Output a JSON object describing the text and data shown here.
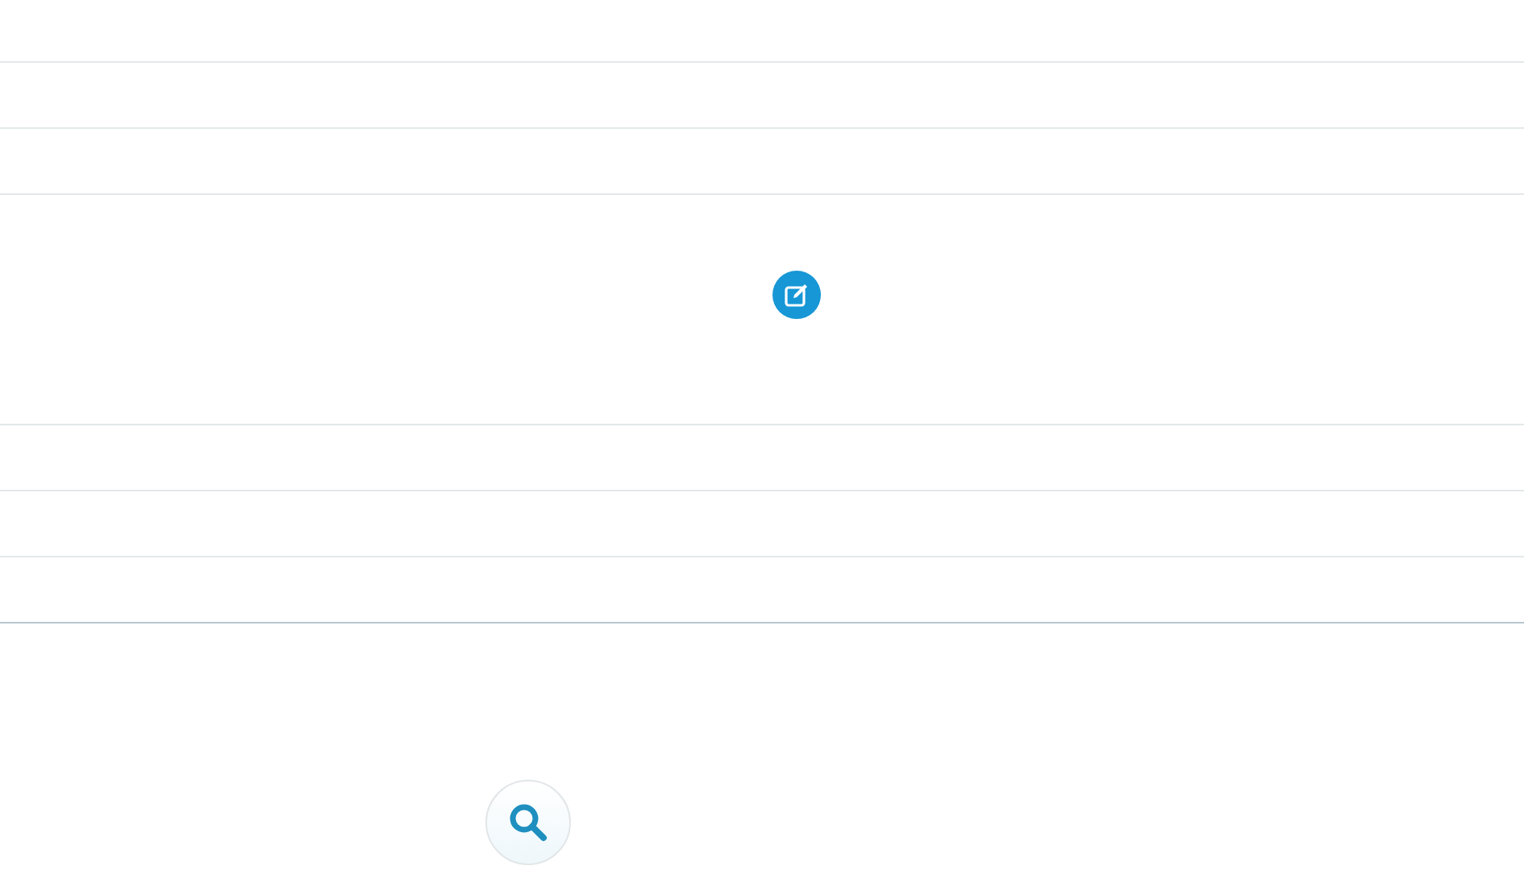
{
  "rows": [
    {
      "kind": "blank"
    },
    {
      "kind": "blank"
    },
    {
      "kind": "blank"
    },
    {
      "kind": "edit"
    },
    {
      "kind": "blank"
    },
    {
      "kind": "blank"
    },
    {
      "kind": "blank"
    }
  ],
  "search_button": {
    "kind": "search"
  }
}
